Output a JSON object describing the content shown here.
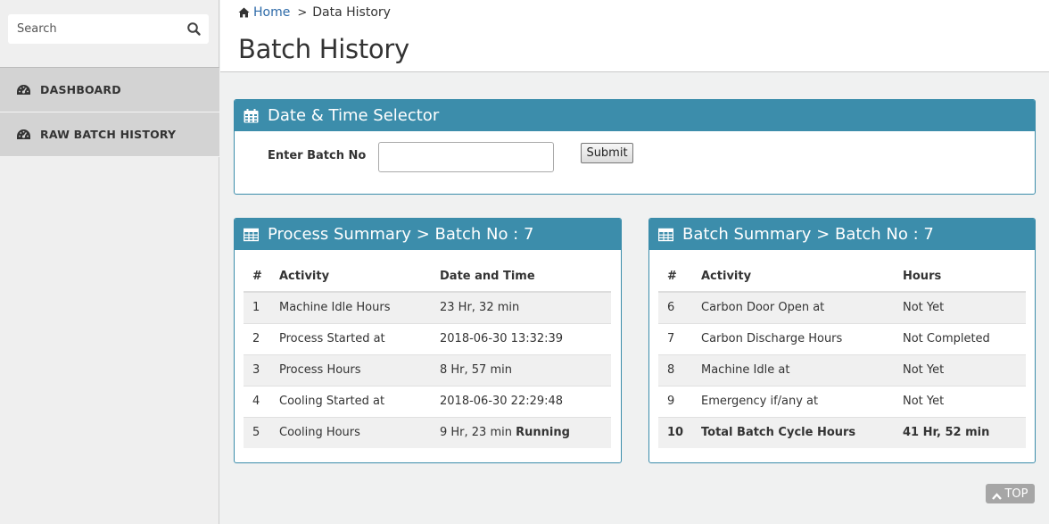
{
  "sidebar": {
    "search": {
      "placeholder": "Search"
    },
    "items": [
      {
        "label": "DASHBOARD",
        "icon": "dashboard-icon"
      },
      {
        "label": "RAW BATCH HISTORY",
        "icon": "dashboard-icon"
      }
    ]
  },
  "header": {
    "breadcrumb": {
      "home": "Home",
      "separator": ">",
      "current": "Data History"
    },
    "title": "Batch History"
  },
  "date_selector": {
    "title": "Date & Time Selector",
    "batch_label": "Enter Batch No",
    "batch_value": "",
    "submit_label": "Submit"
  },
  "process_summary": {
    "title": "Process Summary > Batch No : 7",
    "columns": [
      "#",
      "Activity",
      "Date and Time"
    ],
    "rows": [
      {
        "num": "1",
        "activity": "Machine Idle Hours",
        "value": "23 Hr, 32 min",
        "extra": ""
      },
      {
        "num": "2",
        "activity": "Process Started at",
        "value": "2018-06-30 13:32:39",
        "extra": ""
      },
      {
        "num": "3",
        "activity": "Process Hours",
        "value": "8 Hr, 57 min",
        "extra": ""
      },
      {
        "num": "4",
        "activity": "Cooling Started at",
        "value": "2018-06-30 22:29:48",
        "extra": ""
      },
      {
        "num": "5",
        "activity": "Cooling Hours",
        "value": "9 Hr, 23 min",
        "extra": "Running"
      }
    ]
  },
  "batch_summary": {
    "title": "Batch Summary > Batch No : 7",
    "columns": [
      "#",
      "Activity",
      "Hours"
    ],
    "rows": [
      {
        "num": "6",
        "activity": "Carbon Door Open at",
        "value": "Not Yet"
      },
      {
        "num": "7",
        "activity": "Carbon Discharge Hours",
        "value": "Not Completed"
      },
      {
        "num": "8",
        "activity": "Machine Idle at",
        "value": "Not Yet"
      },
      {
        "num": "9",
        "activity": "Emergency if/any at",
        "value": "Not Yet"
      },
      {
        "num": "10",
        "activity": "Total Batch Cycle Hours",
        "value": "41 Hr, 52 min"
      }
    ]
  },
  "top_button": {
    "label": "TOP"
  },
  "colors": {
    "accent": "#3c8dab",
    "link": "#2d6aa8",
    "sidebar_item": "#d3d3d3",
    "top_button": "#a6a6a6"
  }
}
